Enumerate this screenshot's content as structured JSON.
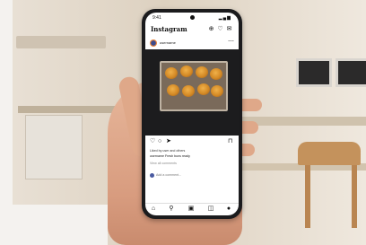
{
  "app": {
    "name": "Instagram",
    "status_time": "9:41",
    "status_icons": "▂▄▆"
  },
  "header": {
    "logo": "Instagram",
    "icons": [
      "plus-icon",
      "heart-icon",
      "messenger-icon"
    ]
  },
  "post": {
    "username": "username",
    "media_alt": "tray of baked buns",
    "actions": [
      "heart-icon",
      "comment-icon",
      "share-icon",
      "bookmark-icon"
    ],
    "caption_lines": [
      "Liked by user and others",
      "username Fresh buns ready",
      "View all comments"
    ],
    "meta": "Add a comment..."
  },
  "tabbar": {
    "icons": [
      "home-icon",
      "search-icon",
      "reels-icon",
      "shop-icon",
      "profile-icon"
    ]
  }
}
